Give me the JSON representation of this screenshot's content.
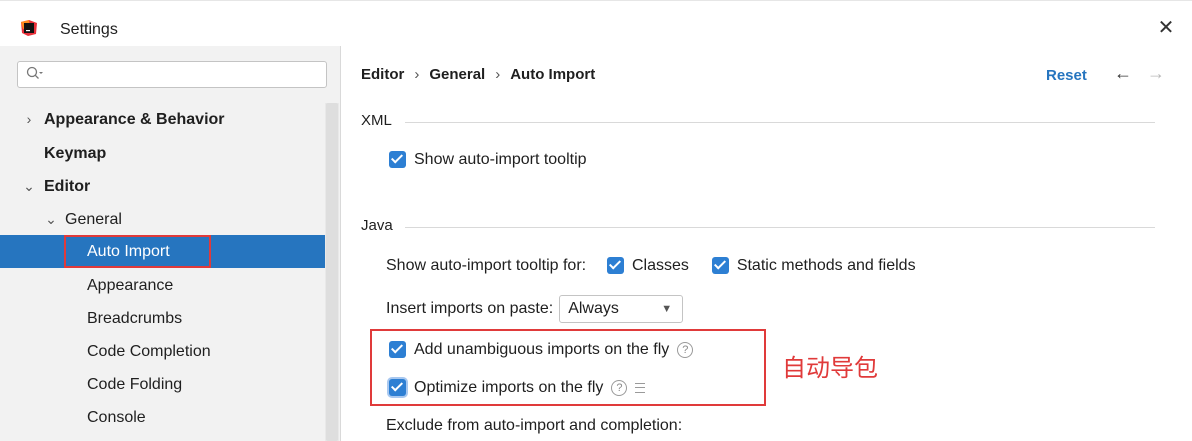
{
  "window": {
    "title": "Settings",
    "close_label": "✕"
  },
  "sidebar": {
    "search": {
      "placeholder": ""
    },
    "items": [
      {
        "label": "Appearance & Behavior",
        "chevron": "›"
      },
      {
        "label": "Keymap"
      },
      {
        "label": "Editor",
        "chevron": "⌄"
      },
      {
        "label": "General",
        "chevron": "⌄"
      },
      {
        "label": "Auto Import"
      },
      {
        "label": "Appearance"
      },
      {
        "label": "Breadcrumbs"
      },
      {
        "label": "Code Completion"
      },
      {
        "label": "Code Folding"
      },
      {
        "label": "Console"
      }
    ]
  },
  "main": {
    "breadcrumb": [
      "Editor",
      "General",
      "Auto Import"
    ],
    "breadcrumb_sep": "›",
    "reset_label": "Reset",
    "back_icon": "←",
    "forward_icon": "→",
    "xml": {
      "title": "XML",
      "show_tooltip_label": "Show auto-import tooltip"
    },
    "java": {
      "title": "Java",
      "tooltip_for_label": "Show auto-import tooltip for:",
      "classes_label": "Classes",
      "static_label": "Static methods and fields",
      "insert_on_paste_label": "Insert imports on paste:",
      "insert_on_paste_value": "Always",
      "add_unambiguous_label": "Add unambiguous imports on the fly",
      "optimize_label": "Optimize imports on the fly",
      "exclude_label": "Exclude from auto-import and completion:"
    },
    "annotation": "自动导包",
    "help_glyph": "?"
  },
  "colors": {
    "accent": "#2675bf",
    "checkbox": "#2d7fd3",
    "annotation": "#e03a3a"
  }
}
